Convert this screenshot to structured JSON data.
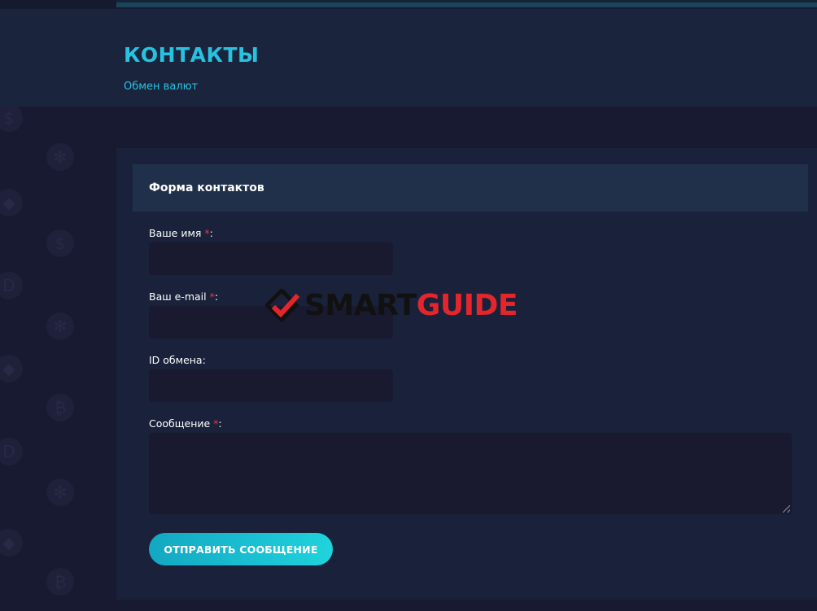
{
  "header": {
    "title": "КОНТАКТЫ",
    "breadcrumb": "Обмен валют"
  },
  "form": {
    "title": "Форма контактов",
    "required_mark": "*",
    "fields": {
      "name": {
        "label": "Ваше имя ",
        "suffix": ":",
        "value": ""
      },
      "email": {
        "label": "Ваш e-mail ",
        "suffix": ":",
        "value": ""
      },
      "exchange_id": {
        "label": "ID обмена:",
        "value": ""
      },
      "message": {
        "label": "Сообщение ",
        "suffix": ":",
        "value": ""
      }
    },
    "submit_label": "ОТПРАВИТЬ СООБЩЕНИЕ"
  },
  "watermark": {
    "part1": "SMART",
    "part2": "GUIDE"
  },
  "colors": {
    "accent": "#28c2e0",
    "required": "#e5384a",
    "button_start": "#14a7c2",
    "button_end": "#1fd3dc",
    "background": "#181a31",
    "card": "#19223a",
    "watermark_red": "#e4262c"
  },
  "icons": [
    "coin-icon",
    "ripple-icon",
    "ethereum-icon",
    "bitcoin-icon",
    "dash-icon"
  ]
}
